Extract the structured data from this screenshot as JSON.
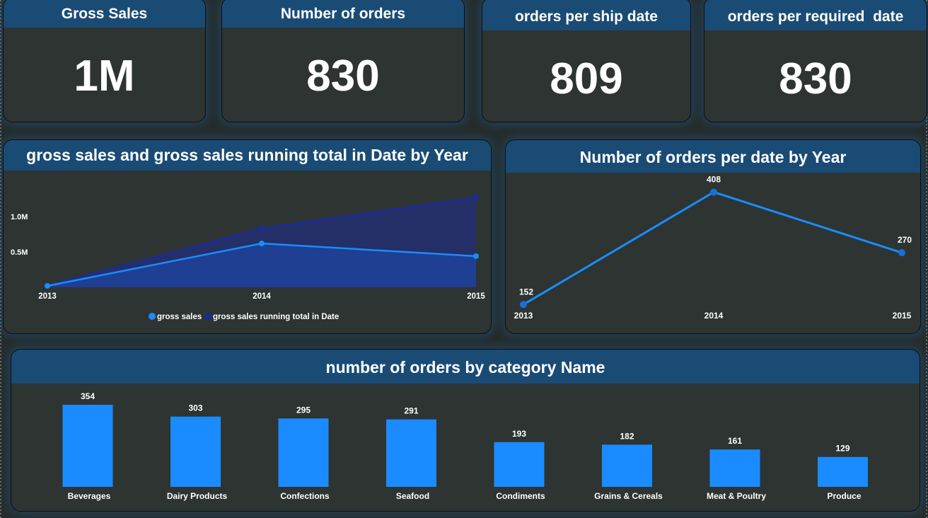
{
  "kpis": [
    {
      "title": "Gross Sales",
      "value": "1M"
    },
    {
      "title": "Number of orders",
      "value": "830"
    },
    {
      "title": "orders per ship date",
      "value": "809"
    },
    {
      "title": "orders per required  date",
      "value": "830"
    }
  ],
  "colors": {
    "accent": "#1a8cff",
    "running_total": "#1a2aa0",
    "header": "#1a4b75",
    "card_bg": "#2d3432"
  },
  "area_chart": {
    "title": "gross sales and gross sales running total in Date by Year",
    "chart_data": {
      "type": "area",
      "title": "gross sales and gross sales running total in Date by Year",
      "x": [
        "2013",
        "2014",
        "2015"
      ],
      "ylim": [
        0,
        1.3
      ],
      "y_ticks": [
        "0.5M",
        "1.0M"
      ],
      "y_tick_values": [
        0.5,
        1.0
      ],
      "series": [
        {
          "name": "gross sales",
          "values": [
            0.02,
            0.62,
            0.44
          ]
        },
        {
          "name": "gross sales running total in Date",
          "values": [
            0.02,
            0.83,
            1.27
          ]
        }
      ],
      "legend_position": "bottom"
    }
  },
  "line_chart": {
    "title": "Number of orders per date by Year",
    "chart_data": {
      "type": "line",
      "title": "Number of orders per date by Year",
      "x": [
        "2013",
        "2014",
        "2015"
      ],
      "values": [
        152,
        408,
        270
      ],
      "data_labels": [
        "152",
        "408",
        "270"
      ],
      "ylim": [
        130,
        420
      ]
    }
  },
  "bar_chart": {
    "title": "number of orders by category Name",
    "chart_data": {
      "type": "bar",
      "title": "number of orders by category Name",
      "categories": [
        "Beverages",
        "Dairy Products",
        "Confections",
        "Seafood",
        "Condiments",
        "Grains & Cereals",
        "Meat & Poultry",
        "Produce"
      ],
      "values": [
        354,
        303,
        295,
        291,
        193,
        182,
        161,
        129
      ],
      "data_labels": [
        "354",
        "303",
        "295",
        "291",
        "193",
        "182",
        "161",
        "129"
      ],
      "ylim": [
        0,
        354
      ]
    }
  }
}
